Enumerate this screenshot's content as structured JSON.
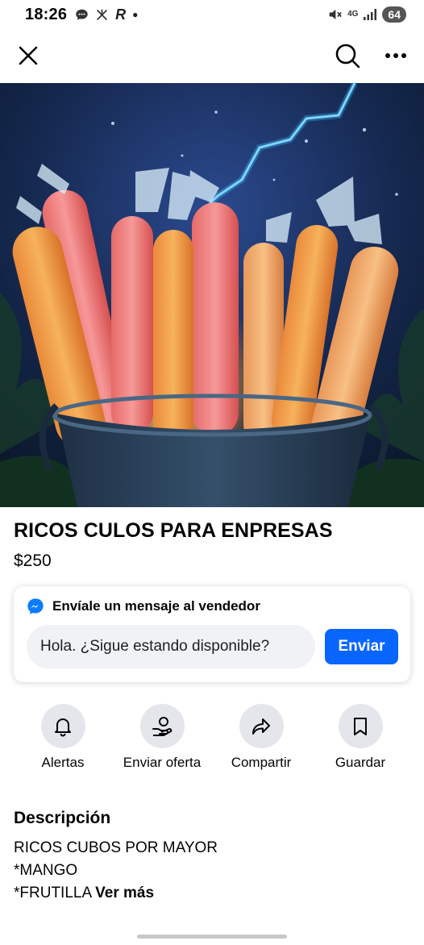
{
  "status_bar": {
    "time": "18:26",
    "network": "4G",
    "battery": "64"
  },
  "listing": {
    "title": "RICOS CULOS PARA ENPRESAS",
    "price": "$250"
  },
  "message_card": {
    "header": "Envíale un mensaje al vendedor",
    "input_value": "Hola. ¿Sigue estando disponible?",
    "send_label": "Enviar"
  },
  "actions": [
    {
      "label": "Alertas",
      "icon": "bell-icon"
    },
    {
      "label": "Enviar oferta",
      "icon": "offer-icon"
    },
    {
      "label": "Compartir",
      "icon": "share-icon"
    },
    {
      "label": "Guardar",
      "icon": "bookmark-icon"
    }
  ],
  "description": {
    "heading": "Descripción",
    "lines": [
      "RICOS CUBOS POR MAYOR",
      "*MANGO",
      "*FRUTILLA"
    ],
    "see_more": "Ver más"
  },
  "colors": {
    "accent": "#0866ff",
    "messenger": "#0a7cff",
    "action_bg": "#e4e6eb",
    "input_bg": "#f0f2f5"
  }
}
